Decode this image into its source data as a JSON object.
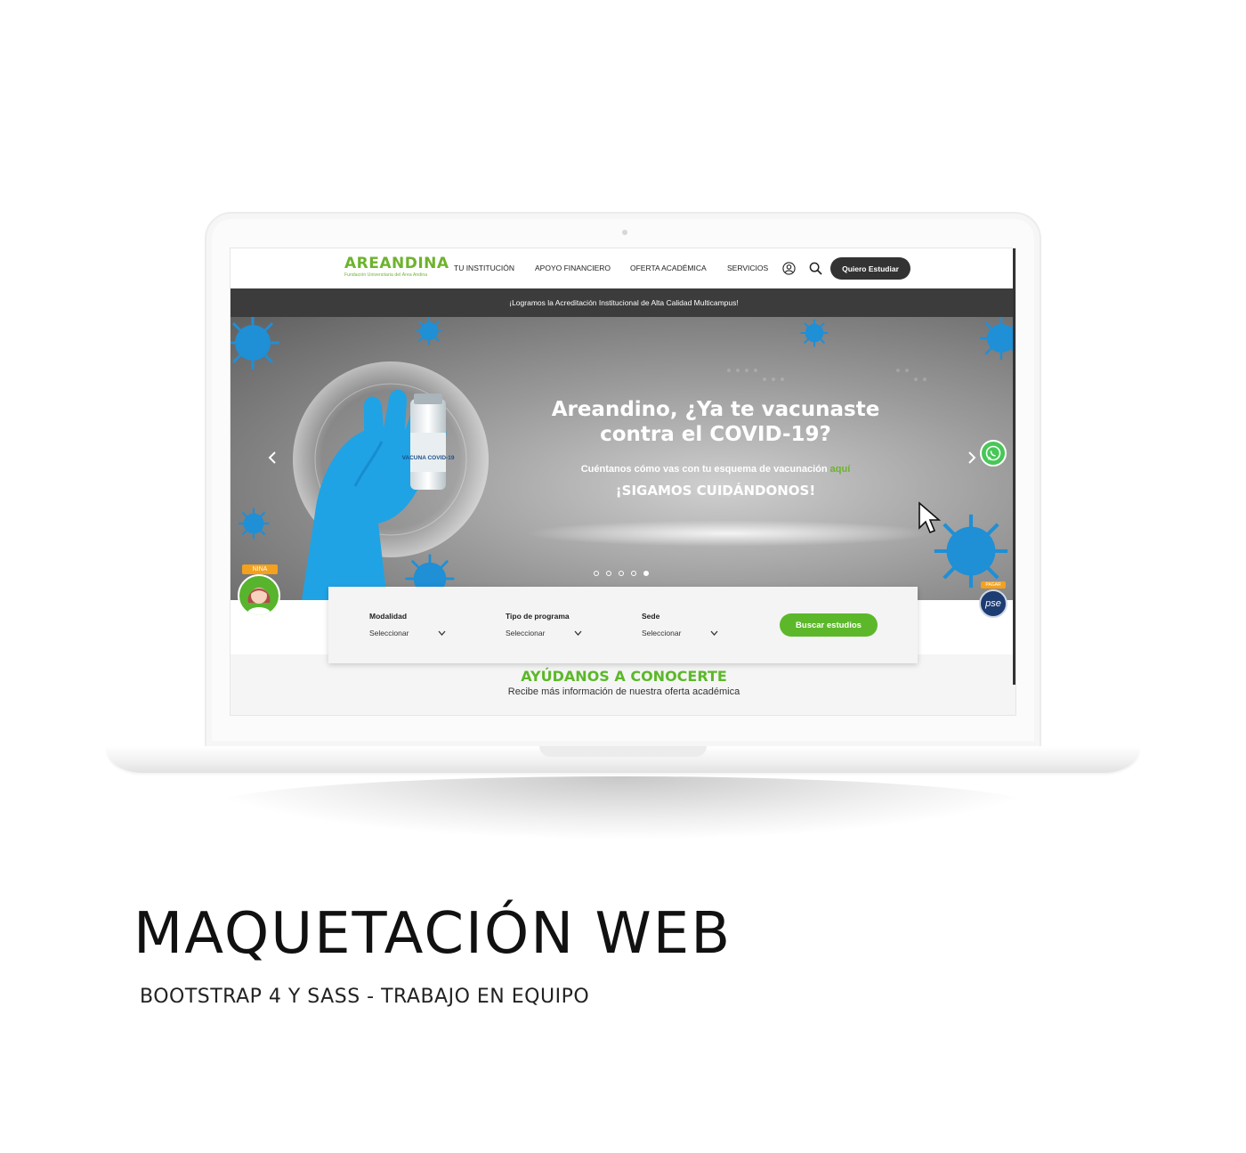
{
  "brand": {
    "logo_text": "AREANDINA",
    "logo_subtitle": "Fundación Universitaria del Área Andina"
  },
  "nav": {
    "items": [
      "TU INSTITUCIÓN",
      "APOYO FINANCIERO",
      "OFERTA ACADÉMICA",
      "SERVICIOS"
    ],
    "cta_label": "Quiero Estudiar"
  },
  "announcement": "¡Logramos la Acreditación Institucional de Alta Calidad Multicampus!",
  "hero": {
    "title": "Areandino, ¿Ya te vacunaste contra el COVID-19?",
    "subtitle_text": "Cuéntanos cómo vas con tu esquema de vacunación",
    "subtitle_link": "aquí",
    "tagline": "¡SIGAMOS CUIDÁNDONOS!",
    "vial_label": "VACUNA COVID-19",
    "slide_count": 5,
    "active_slide": 5
  },
  "widgets": {
    "nina_label": "NINA",
    "pse_label": "PAGAR",
    "pse_text": "pse"
  },
  "search": {
    "fields": [
      {
        "label": "Modalidad",
        "value": "Seleccionar"
      },
      {
        "label": "Tipo de programa",
        "value": "Seleccionar"
      },
      {
        "label": "Sede",
        "value": "Seleccionar"
      }
    ],
    "button_label": "Buscar estudios"
  },
  "section": {
    "title": "AYÚDANOS A CONOCERTE",
    "subtitle": "Recibe más información de nuestra oferta académica"
  },
  "caption": {
    "title": "MAQUETACIÓN WEB",
    "subtitle": "BOOTSTRAP 4 Y SASS - TRABAJO EN EQUIPO"
  },
  "colors": {
    "brand_green": "#6db32d",
    "button_green": "#5cb82a",
    "virus_blue": "#1f8fd6",
    "dark": "#333333",
    "nina_orange": "#f4a11d"
  }
}
